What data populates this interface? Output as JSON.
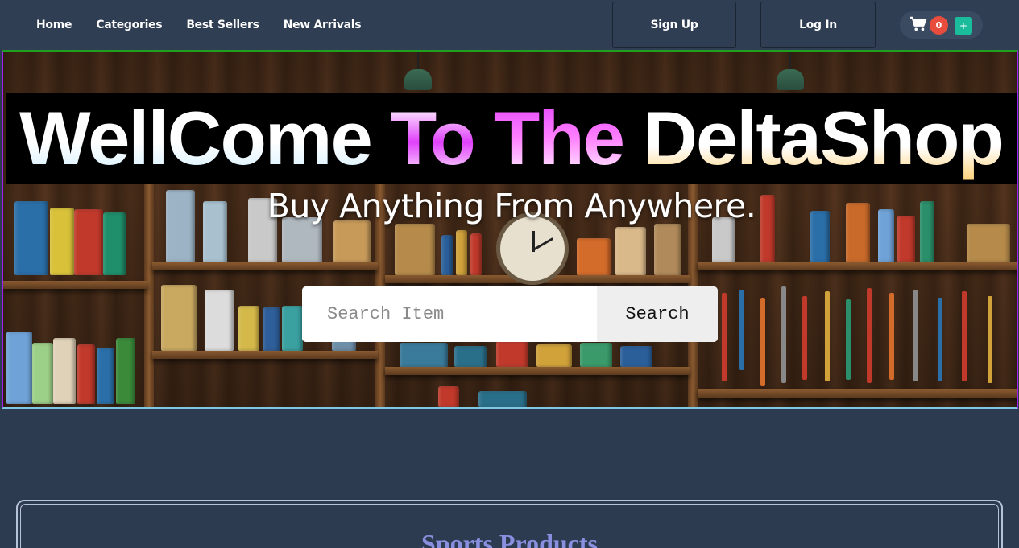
{
  "nav": {
    "links": [
      {
        "label": "Home"
      },
      {
        "label": "Categories"
      },
      {
        "label": "Best Sellers"
      },
      {
        "label": "New Arrivals"
      }
    ],
    "signup_label": "Sign Up",
    "login_label": "Log In",
    "cart": {
      "icon": "shopping-cart-icon",
      "count": "0",
      "add_label": "+"
    }
  },
  "hero": {
    "title_parts": [
      "WellCome",
      "To",
      "The",
      "DeltaShop"
    ],
    "subtitle": "Buy Anything From Anywhere.",
    "search": {
      "placeholder": "Search Item",
      "value": "",
      "button_label": "Search"
    }
  },
  "section": {
    "title": "Sports Products"
  },
  "colors": {
    "nav_bg": "#2f3e53",
    "page_bg": "#2d3b50",
    "badge": "#e84c3d",
    "add_button": "#1abc9c",
    "title_accent": "#e040fb",
    "section_title": "#8a8fe0"
  }
}
